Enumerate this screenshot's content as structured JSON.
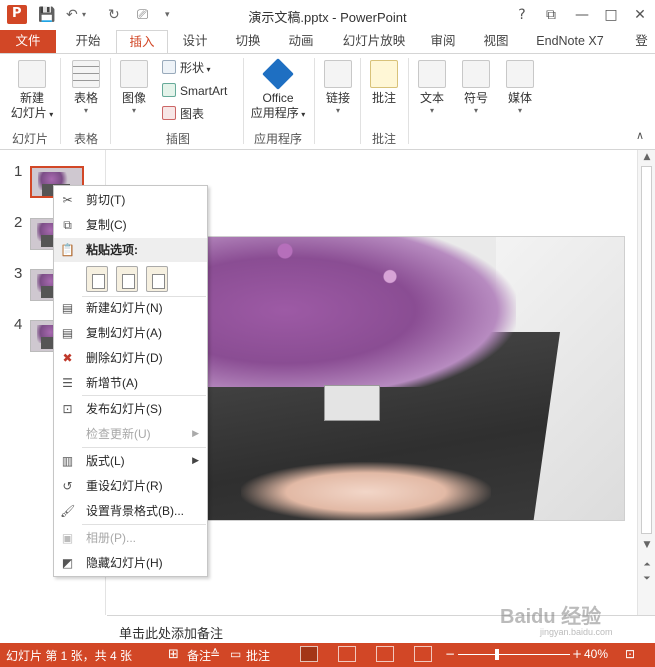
{
  "app": {
    "title": "演示文稿.pptx - PowerPoint"
  },
  "window_buttons": {
    "help": "?",
    "restore": "⧉",
    "minimize": "—",
    "maximize": "□",
    "close": "✕"
  },
  "tabs": [
    {
      "label": "文件"
    },
    {
      "label": "开始"
    },
    {
      "label": "插入"
    },
    {
      "label": "设计"
    },
    {
      "label": "切换"
    },
    {
      "label": "动画"
    },
    {
      "label": "幻灯片放映"
    },
    {
      "label": "审阅"
    },
    {
      "label": "视图"
    },
    {
      "label": "EndNote X7"
    },
    {
      "label": "登"
    }
  ],
  "ribbon": {
    "new_slide": [
      "新建",
      "幻灯片"
    ],
    "table": "表格",
    "image": "图像",
    "shape": "形状",
    "smartart": "SmartArt",
    "chart": "图表",
    "office_apps": [
      "Office",
      "应用程序"
    ],
    "link": "链接",
    "comment": "批注",
    "text": "文本",
    "symbol": "符号",
    "media": "媒体",
    "groups": {
      "slides": "幻灯片",
      "tables": "表格",
      "illustrations": "插图",
      "apps": "应用程序",
      "comments": "批注"
    }
  },
  "thumbnails": [
    "1",
    "2",
    "3",
    "4"
  ],
  "context_menu": {
    "cut": "剪切(T)",
    "copy": "复制(C)",
    "paste_options": "粘贴选项:",
    "new_slide": "新建幻灯片(N)",
    "duplicate_slide": "复制幻灯片(A)",
    "delete_slide": "删除幻灯片(D)",
    "add_section": "新增节(A)",
    "publish_slides": "发布幻灯片(S)",
    "check_updates": "检查更新(U)",
    "layout": "版式(L)",
    "reset_slide": "重设幻灯片(R)",
    "format_background": "设置背景格式(B)...",
    "photo_album": "相册(P)...",
    "hide_slide": "隐藏幻灯片(H)"
  },
  "notes_placeholder": "单击此处添加备注",
  "statusbar": {
    "slide_info": "幻灯片 第 1 张，共 4 张",
    "notes": "备注",
    "comments": "批注",
    "zoom": "40%"
  },
  "watermark": {
    "main": "Baidu 经验",
    "sub": "jingyan.baidu.com"
  }
}
